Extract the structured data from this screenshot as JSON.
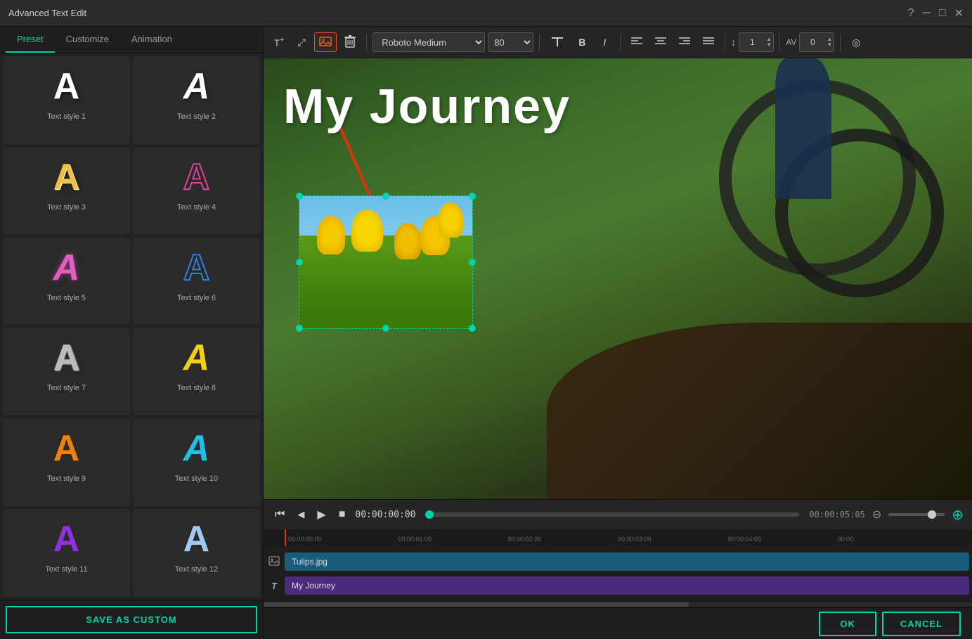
{
  "window": {
    "title": "Advanced Text Edit",
    "controls": [
      "help",
      "minimize",
      "maximize",
      "close"
    ]
  },
  "tabs": [
    {
      "id": "preset",
      "label": "Preset",
      "active": true
    },
    {
      "id": "customize",
      "label": "Customize",
      "active": false
    },
    {
      "id": "animation",
      "label": "Animation",
      "active": false
    }
  ],
  "presets": [
    {
      "id": 1,
      "label": "Text style 1",
      "styleClass": "style1",
      "letter": "A"
    },
    {
      "id": 2,
      "label": "Text style 2",
      "styleClass": "style2",
      "letter": "A"
    },
    {
      "id": 3,
      "label": "Text style 3",
      "styleClass": "style3",
      "letter": "A"
    },
    {
      "id": 4,
      "label": "Text style 4",
      "styleClass": "style4",
      "letter": "A"
    },
    {
      "id": 5,
      "label": "Text style 5",
      "styleClass": "style5",
      "letter": "A"
    },
    {
      "id": 6,
      "label": "Text style 6",
      "styleClass": "style6",
      "letter": "A"
    },
    {
      "id": 7,
      "label": "Text style 7",
      "styleClass": "style7",
      "letter": "A"
    },
    {
      "id": 8,
      "label": "Text style 8",
      "styleClass": "style8",
      "letter": "A"
    },
    {
      "id": 9,
      "label": "Text style 9",
      "styleClass": "style9",
      "letter": "A"
    },
    {
      "id": 10,
      "label": "Text style 10",
      "styleClass": "style10",
      "letter": "A"
    },
    {
      "id": 11,
      "label": "Text style 11",
      "styleClass": "style11",
      "letter": "A"
    },
    {
      "id": 12,
      "label": "Text style 12",
      "styleClass": "style12",
      "letter": "A"
    }
  ],
  "saveCustomLabel": "SAVE AS CUSTOM",
  "toolbar": {
    "addTextLabel": "T+",
    "resizeIcon": "⤡",
    "imageIcon": "🖼",
    "deleteIcon": "🗑",
    "fontName": "Roboto Medium",
    "fontSize": "80",
    "boldIcon": "B",
    "italicIcon": "I",
    "alignLeftIcon": "≡",
    "alignCenterIcon": "≡",
    "alignRightIcon": "≡",
    "alignJustifyIcon": "≡",
    "spacingIcon": "↕",
    "spacingValue": "1",
    "abcIcon": "AB",
    "abcValue": "0",
    "targetIcon": "◎"
  },
  "preview": {
    "overlayText": "My Journey",
    "imageName": "Tulips.jpg"
  },
  "playback": {
    "rewind": "⏮",
    "prevFrame": "◀",
    "play": "▶",
    "stop": "■",
    "currentTime": "00:00:00:00",
    "endTime": "00:00:05:05"
  },
  "timeline": {
    "rulerMarks": [
      "00:00:00:00",
      "00:00:01:00",
      "00:00:02:00",
      "00:00:03:00",
      "00:00:04:00",
      "00:00:"
    ],
    "tracks": [
      {
        "icon": "🖼",
        "label": "Tulips.jpg",
        "type": "image"
      },
      {
        "icon": "T",
        "label": "My Journey",
        "type": "text"
      }
    ]
  },
  "actions": {
    "ok": "OK",
    "cancel": "CANCEL"
  }
}
